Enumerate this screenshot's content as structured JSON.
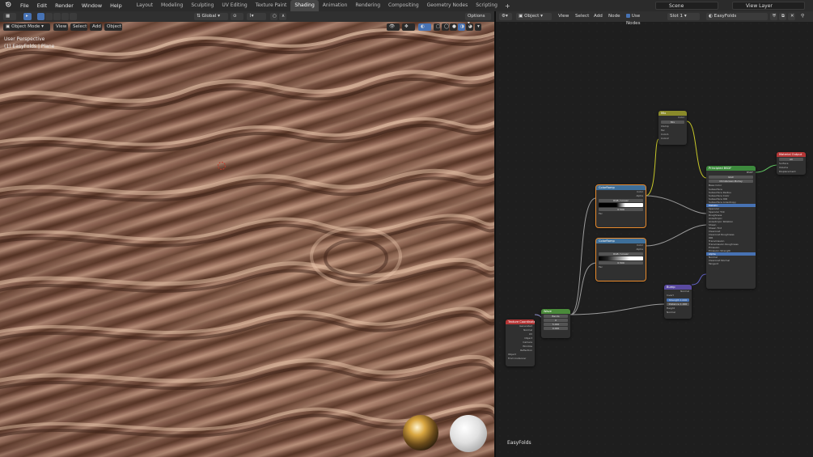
{
  "menu": [
    "File",
    "Edit",
    "Render",
    "Window",
    "Help"
  ],
  "workspaces": [
    "Layout",
    "Modeling",
    "Sculpting",
    "UV Editing",
    "Texture Paint",
    "Shading",
    "Animation",
    "Rendering",
    "Compositing",
    "Geometry Nodes",
    "Scripting"
  ],
  "active_workspace": "Shading",
  "scene": "Scene",
  "view_layer": "View Layer",
  "viewport": {
    "mode": "Object Mode",
    "menus": [
      "View",
      "Select",
      "Add",
      "Object"
    ],
    "transform_orientation": "Global",
    "options_label": "Options",
    "perspective_label": "User Perspective",
    "object_label": "(1) EasyFolds | Plane"
  },
  "node_editor": {
    "object_dropdown": "Object",
    "menus": [
      "View",
      "Select",
      "Add",
      "Node"
    ],
    "use_nodes_label": "Use Nodes",
    "slot": "Slot 1",
    "material": "EasyFolds",
    "footer_label": "EasyFolds"
  },
  "nodes": {
    "tex_coord": {
      "title": "Texture Coordinate",
      "outputs": [
        "Generated",
        "Normal",
        "UV",
        "Object",
        "Camera",
        "Window",
        "Reflection"
      ],
      "object_label": "Object",
      "from_instancer": "From Instancer"
    },
    "wave": {
      "title": "Wave",
      "type": "Bands",
      "dir": "X",
      "profile": "Sine",
      "scale": "5.000",
      "distortion": "0.000"
    },
    "ramp1": {
      "title": "ColorRamp",
      "mode": "RGB",
      "interp": "Linear",
      "pos": "0.500",
      "outputs": [
        "Color",
        "Alpha"
      ],
      "input": "Fac"
    },
    "ramp2": {
      "title": "ColorRamp",
      "mode": "RGB",
      "interp": "Linear",
      "pos": "0.500",
      "outputs": [
        "Color",
        "Alpha"
      ],
      "input": "Fac"
    },
    "mix": {
      "title": "Mix",
      "rows": [
        "Color",
        "Mix",
        "Clamp",
        "Fac",
        "Color1",
        "Color2"
      ]
    },
    "bump": {
      "title": "Bump",
      "rows": [
        "Normal",
        "Invert",
        "Strength",
        "Distance",
        "Height",
        "Normal"
      ],
      "strength": "1.000",
      "distance": "1.000"
    },
    "bsdf": {
      "title": "Principled BSDF",
      "rows": [
        "BSDF",
        "GGX",
        "Christensen-Burley",
        "Base Color",
        "Subsurface",
        "Subsurface Radius",
        "Subsurface Color",
        "Subsurface IOR",
        "Subsurface Anisotropy",
        "Metallic",
        "Specular",
        "Specular Tint",
        "Roughness",
        "Anisotropic",
        "Anisotropic Rotation",
        "Sheen",
        "Sheen Tint",
        "Clearcoat",
        "Clearcoat Roughness",
        "IOR",
        "Transmission",
        "Transmission Roughness",
        "Emission",
        "Emission Strength",
        "Alpha",
        "Normal",
        "Clearcoat Normal",
        "Tangent"
      ]
    },
    "output": {
      "title": "Material Output",
      "target": "All",
      "rows": [
        "Surface",
        "Volume",
        "Displacement"
      ]
    }
  }
}
